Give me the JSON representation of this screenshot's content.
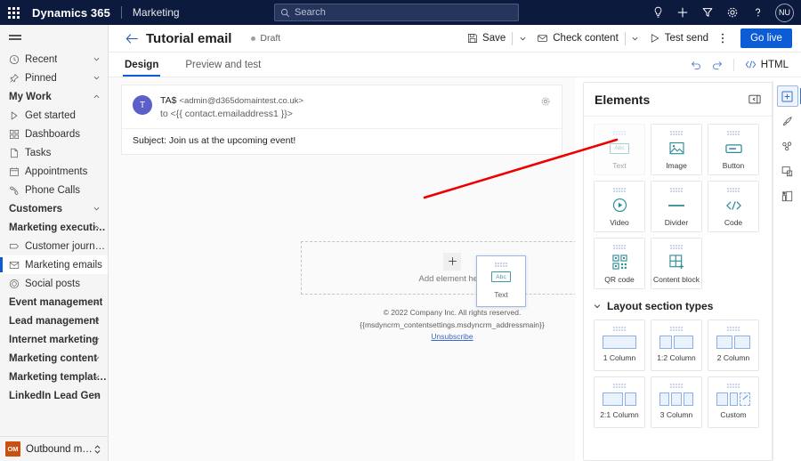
{
  "suite": {
    "waffle_icon": "waffle-icon",
    "brand": "Dynamics 365",
    "app_name": "Marketing",
    "search_placeholder": "Search",
    "icons": [
      {
        "name": "insights-bulb-icon",
        "glyph": "bulb"
      },
      {
        "name": "add-new-icon",
        "glyph": "plus"
      },
      {
        "name": "filter-icon",
        "glyph": "funnel"
      },
      {
        "name": "settings-gear-icon",
        "glyph": "gear"
      },
      {
        "name": "help-icon",
        "glyph": "question"
      }
    ],
    "avatar_initials": "NU"
  },
  "sidebar": {
    "hamburger_label": "Show/hide navigation",
    "items": [
      {
        "label": "Recent",
        "icon": "clock-icon",
        "type": "expandable"
      },
      {
        "label": "Pinned",
        "icon": "pin-icon",
        "type": "expandable"
      },
      {
        "label": "My Work",
        "icon": "",
        "type": "group",
        "expanded": true
      },
      {
        "label": "Get started",
        "icon": "play-outline-icon",
        "type": "sub"
      },
      {
        "label": "Dashboards",
        "icon": "dashboard-icon",
        "type": "sub"
      },
      {
        "label": "Tasks",
        "icon": "task-icon",
        "type": "sub"
      },
      {
        "label": "Appointments",
        "icon": "calendar-icon",
        "type": "sub"
      },
      {
        "label": "Phone Calls",
        "icon": "phone-icon",
        "type": "sub"
      },
      {
        "label": "Customers",
        "icon": "",
        "type": "group",
        "expanded": false
      },
      {
        "label": "Marketing execution",
        "icon": "",
        "type": "group",
        "expanded": true
      },
      {
        "label": "Customer journeys",
        "icon": "journey-icon",
        "type": "sub"
      },
      {
        "label": "Marketing emails",
        "icon": "envelope-icon",
        "type": "sub",
        "selected": true
      },
      {
        "label": "Social posts",
        "icon": "social-icon",
        "type": "sub"
      },
      {
        "label": "Event management",
        "icon": "",
        "type": "group",
        "expanded": false
      },
      {
        "label": "Lead management",
        "icon": "",
        "type": "group",
        "expanded": false
      },
      {
        "label": "Internet marketing",
        "icon": "",
        "type": "group",
        "expanded": false
      },
      {
        "label": "Marketing content",
        "icon": "",
        "type": "group",
        "expanded": false
      },
      {
        "label": "Marketing templates",
        "icon": "",
        "type": "group",
        "expanded": false
      },
      {
        "label": "LinkedIn Lead Gen",
        "icon": "",
        "type": "group",
        "expanded": false
      }
    ],
    "area_switcher": {
      "badge": "OM",
      "label": "Outbound market..."
    }
  },
  "command_bar": {
    "back_icon": "back-arrow-icon",
    "record_title": "Tutorial email",
    "status": "Draft",
    "save_label": "Save",
    "check_content_label": "Check content",
    "test_send_label": "Test send",
    "overflow_label": "More commands",
    "go_live_label": "Go live"
  },
  "tabs": {
    "items": [
      {
        "label": "Design",
        "active": true
      },
      {
        "label": "Preview and test",
        "active": false
      }
    ],
    "undo_icon": "undo-icon",
    "redo_icon": "redo-icon",
    "html_label": "HTML",
    "html_icon": "code-icon"
  },
  "designer": {
    "avatar_initial": "T",
    "from_name": "TA$",
    "from_email": "<admin@d365domaintest.co.uk>",
    "to_line": "to <{{ contact.emailaddress1 }}>",
    "subject": "Subject: Join us at the upcoming event!",
    "settings_icon": "gear-icon",
    "drop_zone_label": "Add element here",
    "plus_icon": "plus-icon",
    "footer_copyright": "© 2022 Company Inc. All rights reserved.",
    "footer_address_token": "{{msdyncrm_contentsettings.msdyncrm_addressmain}}",
    "footer_unsubscribe": "Unsubscribe",
    "dragged_element": {
      "label": "Text",
      "glyph": "Abc"
    }
  },
  "elements_panel": {
    "title": "Elements",
    "collapse_icon": "collapse-panel-icon",
    "elements": [
      {
        "label": "Text",
        "icon": "text-abc-icon",
        "dragging": true
      },
      {
        "label": "Image",
        "icon": "image-icon"
      },
      {
        "label": "Button",
        "icon": "button-icon"
      },
      {
        "label": "Video",
        "icon": "video-play-icon"
      },
      {
        "label": "Divider",
        "icon": "divider-icon"
      },
      {
        "label": "Code",
        "icon": "code-snippet-icon"
      },
      {
        "label": "QR code",
        "icon": "qr-code-icon"
      },
      {
        "label": "Content block",
        "icon": "content-block-icon"
      }
    ],
    "layout_section_title": "Layout section types",
    "layout_expanded": true,
    "layouts": [
      {
        "label": "1 Column",
        "cols": [
          1
        ]
      },
      {
        "label": "1:2 Column",
        "cols": [
          0.42,
          0.58
        ]
      },
      {
        "label": "2 Column",
        "cols": [
          0.5,
          0.5
        ]
      },
      {
        "label": "2:1 Column",
        "cols": [
          0.62,
          0.38
        ]
      },
      {
        "label": "3 Column",
        "cols": [
          0.333,
          0.333,
          0.333
        ]
      },
      {
        "label": "Custom",
        "cols": [
          0.36,
          0.3
        ],
        "custom": true
      }
    ]
  },
  "rail": {
    "buttons": [
      {
        "name": "elements-panel-icon",
        "active": true
      },
      {
        "name": "styles-brush-icon",
        "active": false
      },
      {
        "name": "personalization-icon",
        "active": false
      },
      {
        "name": "preview-device-icon",
        "active": false
      },
      {
        "name": "layers-icon",
        "active": false
      }
    ]
  },
  "annotation": {
    "arrow_color": "#ee0000"
  }
}
